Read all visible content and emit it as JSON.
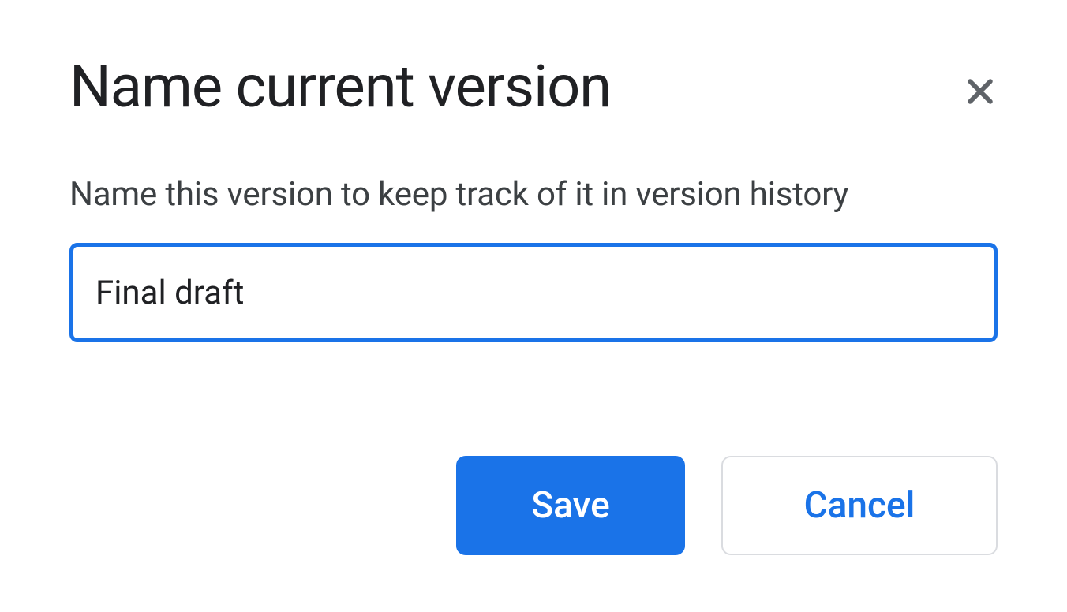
{
  "dialog": {
    "title": "Name current version",
    "helper_text": "Name this version to keep track of it in version history",
    "input_value": "Final draft",
    "save_label": "Save",
    "cancel_label": "Cancel"
  }
}
